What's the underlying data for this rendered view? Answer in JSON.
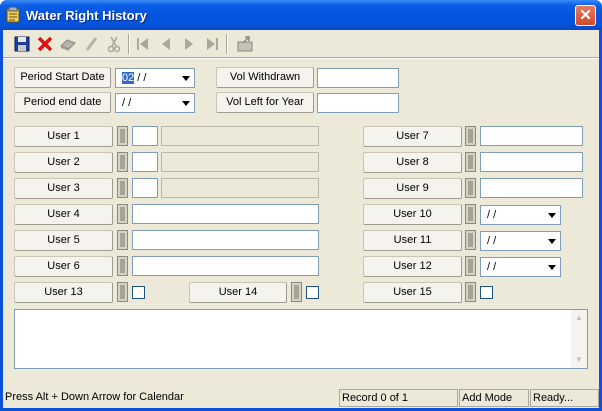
{
  "window": {
    "title": "Water Right History",
    "close_glyph": "✕"
  },
  "toolbar": {
    "icons": [
      "save-icon",
      "delete-icon",
      "print-icon",
      "edit-icon",
      "cut-icon",
      "first-record-icon",
      "previous-record-icon",
      "next-record-icon",
      "last-record-icon",
      "export-icon"
    ]
  },
  "period": {
    "start_label": "Period Start Date",
    "start_value_sel": "02",
    "start_value_rest": " /  /",
    "end_label": "Period end date",
    "end_value": " /  /"
  },
  "vol": {
    "withdrawn_label": "Vol Withdrawn",
    "left_label": "Vol Left for Year",
    "withdrawn_value": "",
    "left_value": ""
  },
  "users": {
    "u1": "User 1",
    "u2": "User 2",
    "u3": "User 3",
    "u4": "User 4",
    "u5": "User 5",
    "u6": "User 6",
    "u7": "User 7",
    "u8": "User 8",
    "u9": "User 9",
    "u10": "User 10",
    "u11": "User 11",
    "u12": "User 12",
    "u13": "User 13",
    "u14": "User 14",
    "u15": "User 15",
    "date_placeholder": " /  /"
  },
  "memo": {
    "value": ""
  },
  "statusbar": {
    "hint": "Press Alt + Down Arrow for Calendar",
    "record": "Record 0 of 1",
    "mode": "Add Mode",
    "state": "Ready..."
  }
}
